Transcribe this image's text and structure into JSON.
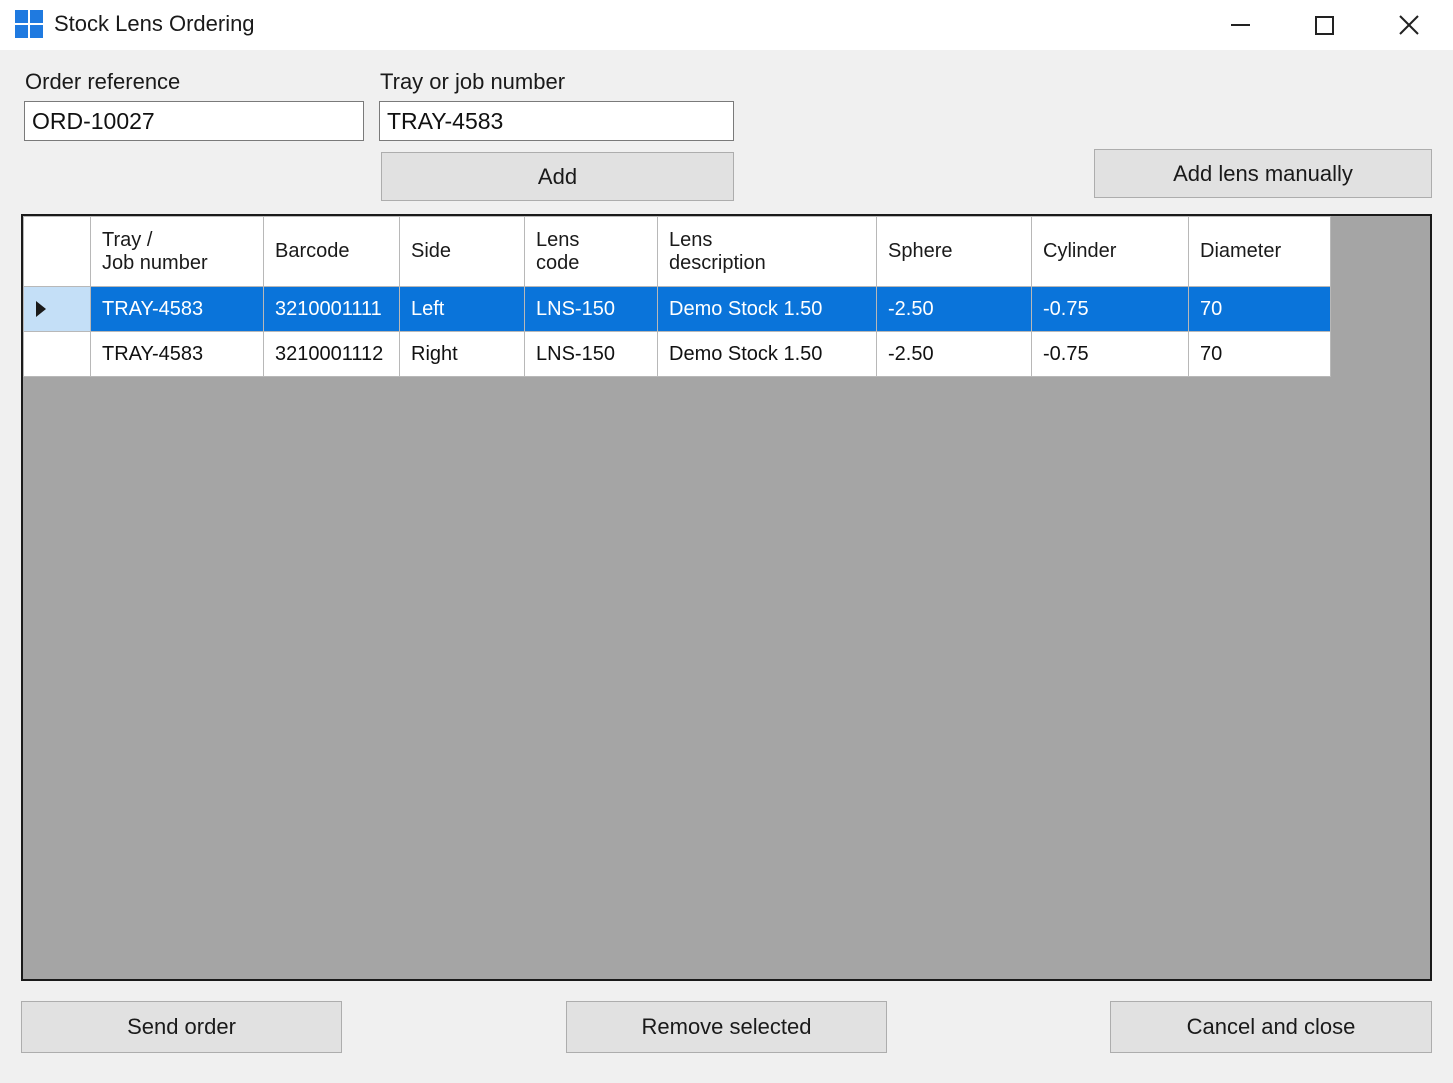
{
  "window": {
    "title": "Stock Lens Ordering"
  },
  "form": {
    "order_reference_label": "Order reference",
    "order_reference_value": "ORD-10027",
    "tray_label": "Tray or job number",
    "tray_value": "TRAY-4583",
    "add_label": "Add",
    "add_manual_label": "Add lens manually"
  },
  "grid": {
    "headers": {
      "tray_line1": "Tray /",
      "tray_line2": "Job number",
      "barcode": "Barcode",
      "side": "Side",
      "code_line1": "Lens",
      "code_line2": "code",
      "desc_line1": "Lens",
      "desc_line2": "description",
      "sphere": "Sphere",
      "cylinder": "Cylinder",
      "diameter": "Diameter"
    },
    "rows": [
      {
        "selected": true,
        "tray": "TRAY-4583",
        "barcode": "3210001111",
        "side": "Left",
        "code": "LNS-150",
        "description": "Demo Stock 1.50",
        "sphere": "-2.50",
        "cylinder": "-0.75",
        "diameter": "70"
      },
      {
        "selected": false,
        "tray": "TRAY-4583",
        "barcode": "3210001112",
        "side": "Right",
        "code": "LNS-150",
        "description": "Demo Stock 1.50",
        "sphere": "-2.50",
        "cylinder": "-0.75",
        "diameter": "70"
      }
    ]
  },
  "footer": {
    "send_label": "Send order",
    "remove_label": "Remove selected",
    "cancel_label": "Cancel and close"
  },
  "colors": {
    "selection": "#0a74da",
    "accent_icon": "#1f7ae0"
  }
}
